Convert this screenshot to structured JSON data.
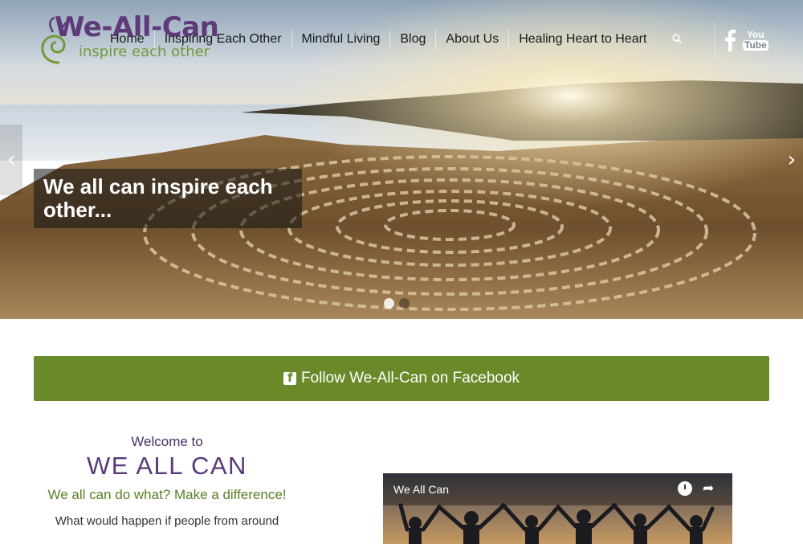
{
  "logo": {
    "name": "We-All-Can",
    "tagline": "inspire each other"
  },
  "nav": {
    "items": [
      "Home",
      "Inspiring Each Other",
      "Mindful Living",
      "Blog",
      "About Us",
      "Healing Heart to Heart"
    ],
    "search_icon": "search-icon"
  },
  "social": {
    "facebook": "facebook-icon",
    "youtube_top": "You",
    "youtube_bottom": "Tube"
  },
  "hero": {
    "caption_line1": "We all can inspire each",
    "caption_line2": "other...",
    "prev_arrow": "‹",
    "next_arrow": "›",
    "active_slide": 1,
    "slide_count": 2
  },
  "facebook_bar": {
    "label": "Follow We-All-Can on Facebook"
  },
  "welcome": {
    "sub": "Welcome to",
    "title": "WE ALL CAN",
    "tagline": "We all can do what? Make a difference!",
    "body": "What would happen if people from around"
  },
  "video": {
    "title": "We All Can",
    "share_glyph": "➦"
  },
  "colors": {
    "green": "#6a8a2a",
    "purple": "#5a3a7a",
    "logo_green": "#6f9b3a"
  }
}
